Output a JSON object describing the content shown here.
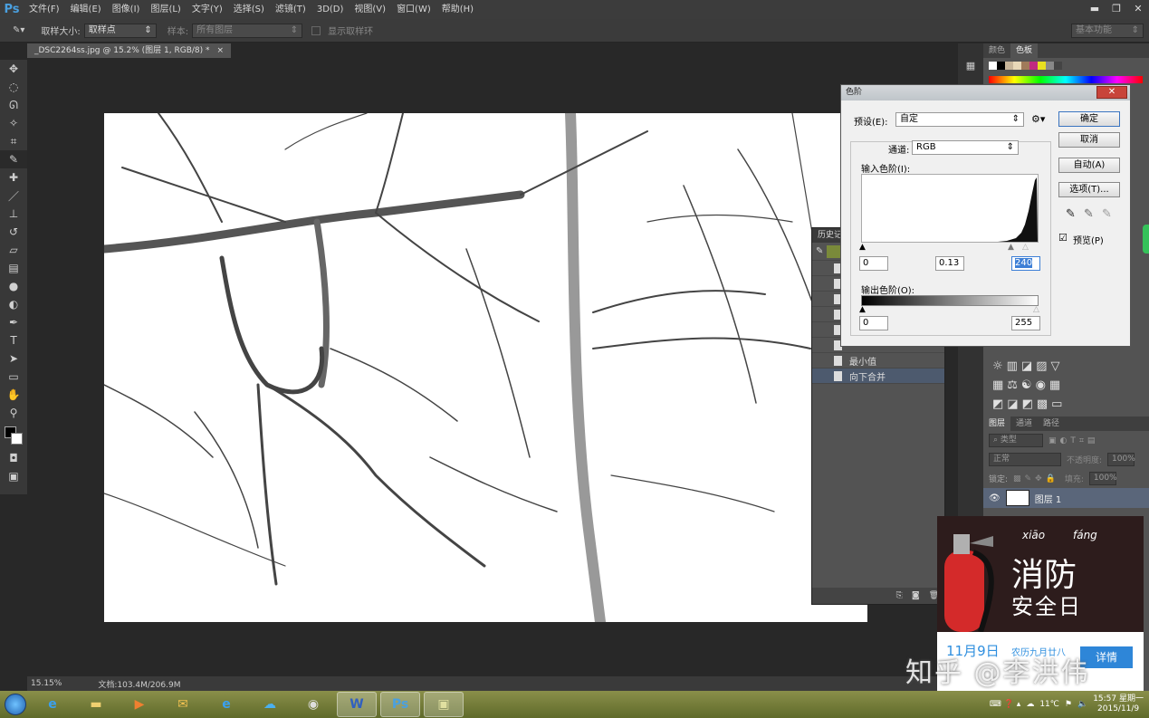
{
  "app": {
    "logo": "Ps"
  },
  "menu": [
    "文件(F)",
    "编辑(E)",
    "图像(I)",
    "图层(L)",
    "文字(Y)",
    "选择(S)",
    "滤镜(T)",
    "3D(D)",
    "视图(V)",
    "窗口(W)",
    "帮助(H)"
  ],
  "window_controls": {
    "minimize": "▬",
    "restore": "❐",
    "close": "✕"
  },
  "options": {
    "sample_size_label": "取样大小:",
    "sample_size_value": "取样点",
    "sample_label": "样本:",
    "sample_value": "所有图层",
    "show_ring_label": "显示取样环",
    "workspace": "基本功能"
  },
  "document": {
    "tab_title": "_DSC2264ss.jpg @ 15.2% (图层 1, RGB/8) *",
    "tab_close": "×",
    "zoom": "15.15%",
    "doc_size": "文档:103.4M/206.9M"
  },
  "history": {
    "title": "历史记",
    "items": [
      {
        "label": ""
      },
      {
        "label": ""
      },
      {
        "label": ""
      },
      {
        "label": ""
      },
      {
        "label": ""
      },
      {
        "label": ""
      },
      {
        "label": "最小值"
      },
      {
        "label": "向下合并"
      }
    ]
  },
  "color_panel": {
    "tab_color": "颜色",
    "tab_swatches": "色板"
  },
  "layers_panel": {
    "tab_layers": "图层",
    "tab_channels": "通道",
    "tab_paths": "路径",
    "filter_kind": "类型",
    "blend_mode": "正常",
    "opacity_label": "不透明度:",
    "opacity_value": "100%",
    "lock_label": "锁定:",
    "fill_label": "填充:",
    "fill_value": "100%",
    "layer1_name": "图层 1"
  },
  "levels": {
    "title": "色阶",
    "close": "✕",
    "preset_label": "预设(E):",
    "preset_value": "自定",
    "channel_label": "通道:",
    "channel_value": "RGB",
    "input_label": "输入色阶(I):",
    "input_black": "0",
    "input_gamma": "0.13",
    "input_white": "240",
    "output_label": "输出色阶(O):",
    "output_black": "0",
    "output_white": "255",
    "ok": "确定",
    "cancel": "取消",
    "auto": "自动(A)",
    "options": "选项(T)...",
    "preview_label": "预览(P)",
    "preview_checked": true
  },
  "popup": {
    "pinyin1": "xiāo",
    "pinyin2": "fáng",
    "title": "消防",
    "subtitle": "安全日",
    "date": "11月9日",
    "lunar": "农历九月廿八",
    "button": "详情"
  },
  "watermark": "知乎 @李洪伟",
  "taskbar": {
    "temperature": "11℃",
    "time": "15:57 星期一",
    "date": "2015/11/9"
  },
  "colors": {
    "accent_blue": "#3d7fd6",
    "ps_blue": "#4aa0e0"
  }
}
